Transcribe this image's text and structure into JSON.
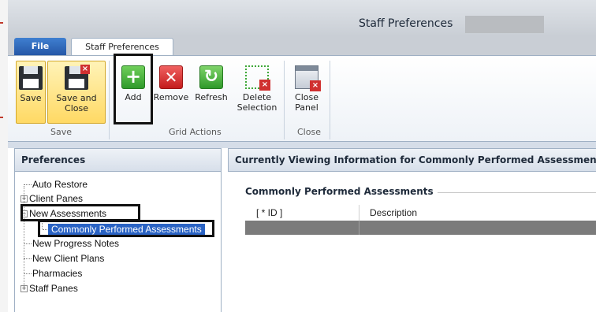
{
  "window": {
    "title": "Staff Preferences"
  },
  "tabs": {
    "file": "File",
    "staff_preferences": "Staff Preferences"
  },
  "ribbon": {
    "save": {
      "label_line1": "Save",
      "label_line2": ""
    },
    "save_and_close": {
      "label_line1": "Save and",
      "label_line2": "Close"
    },
    "add": {
      "label_line1": "Add",
      "label_line2": ""
    },
    "remove": {
      "label_line1": "Remove",
      "label_line2": ""
    },
    "refresh": {
      "label_line1": "Refresh",
      "label_line2": ""
    },
    "delete_selection": {
      "label_line1": "Delete",
      "label_line2": "Selection"
    },
    "close_panel": {
      "label_line1": "Close",
      "label_line2": "Panel"
    },
    "groups": {
      "save": "Save",
      "grid_actions": "Grid Actions",
      "close": "Close"
    }
  },
  "preferences": {
    "header": "Preferences",
    "tree": [
      {
        "label": "Auto Restore",
        "expander": ""
      },
      {
        "label": "Client Panes",
        "expander": "+"
      },
      {
        "label": "New Assessments",
        "expander": "−"
      },
      {
        "label": "Commonly Performed Assessments",
        "expander": ""
      },
      {
        "label": "New Progress Notes",
        "expander": ""
      },
      {
        "label": "New Client Plans",
        "expander": ""
      },
      {
        "label": "Pharmacies",
        "expander": ""
      },
      {
        "label": "Staff Panes",
        "expander": "+"
      }
    ],
    "selected_index": 3
  },
  "main": {
    "header": "Currently Viewing Information for Commonly Performed Assessments",
    "section_title": "Commonly Performed Assessments",
    "grid": {
      "columns": [
        "[ * ID ]",
        "Description"
      ],
      "rows": [
        [
          "",
          ""
        ]
      ]
    }
  },
  "colors": {
    "accent": "#2a63c4",
    "file_tab": "#2557a7",
    "active_button": "#ffd964"
  }
}
